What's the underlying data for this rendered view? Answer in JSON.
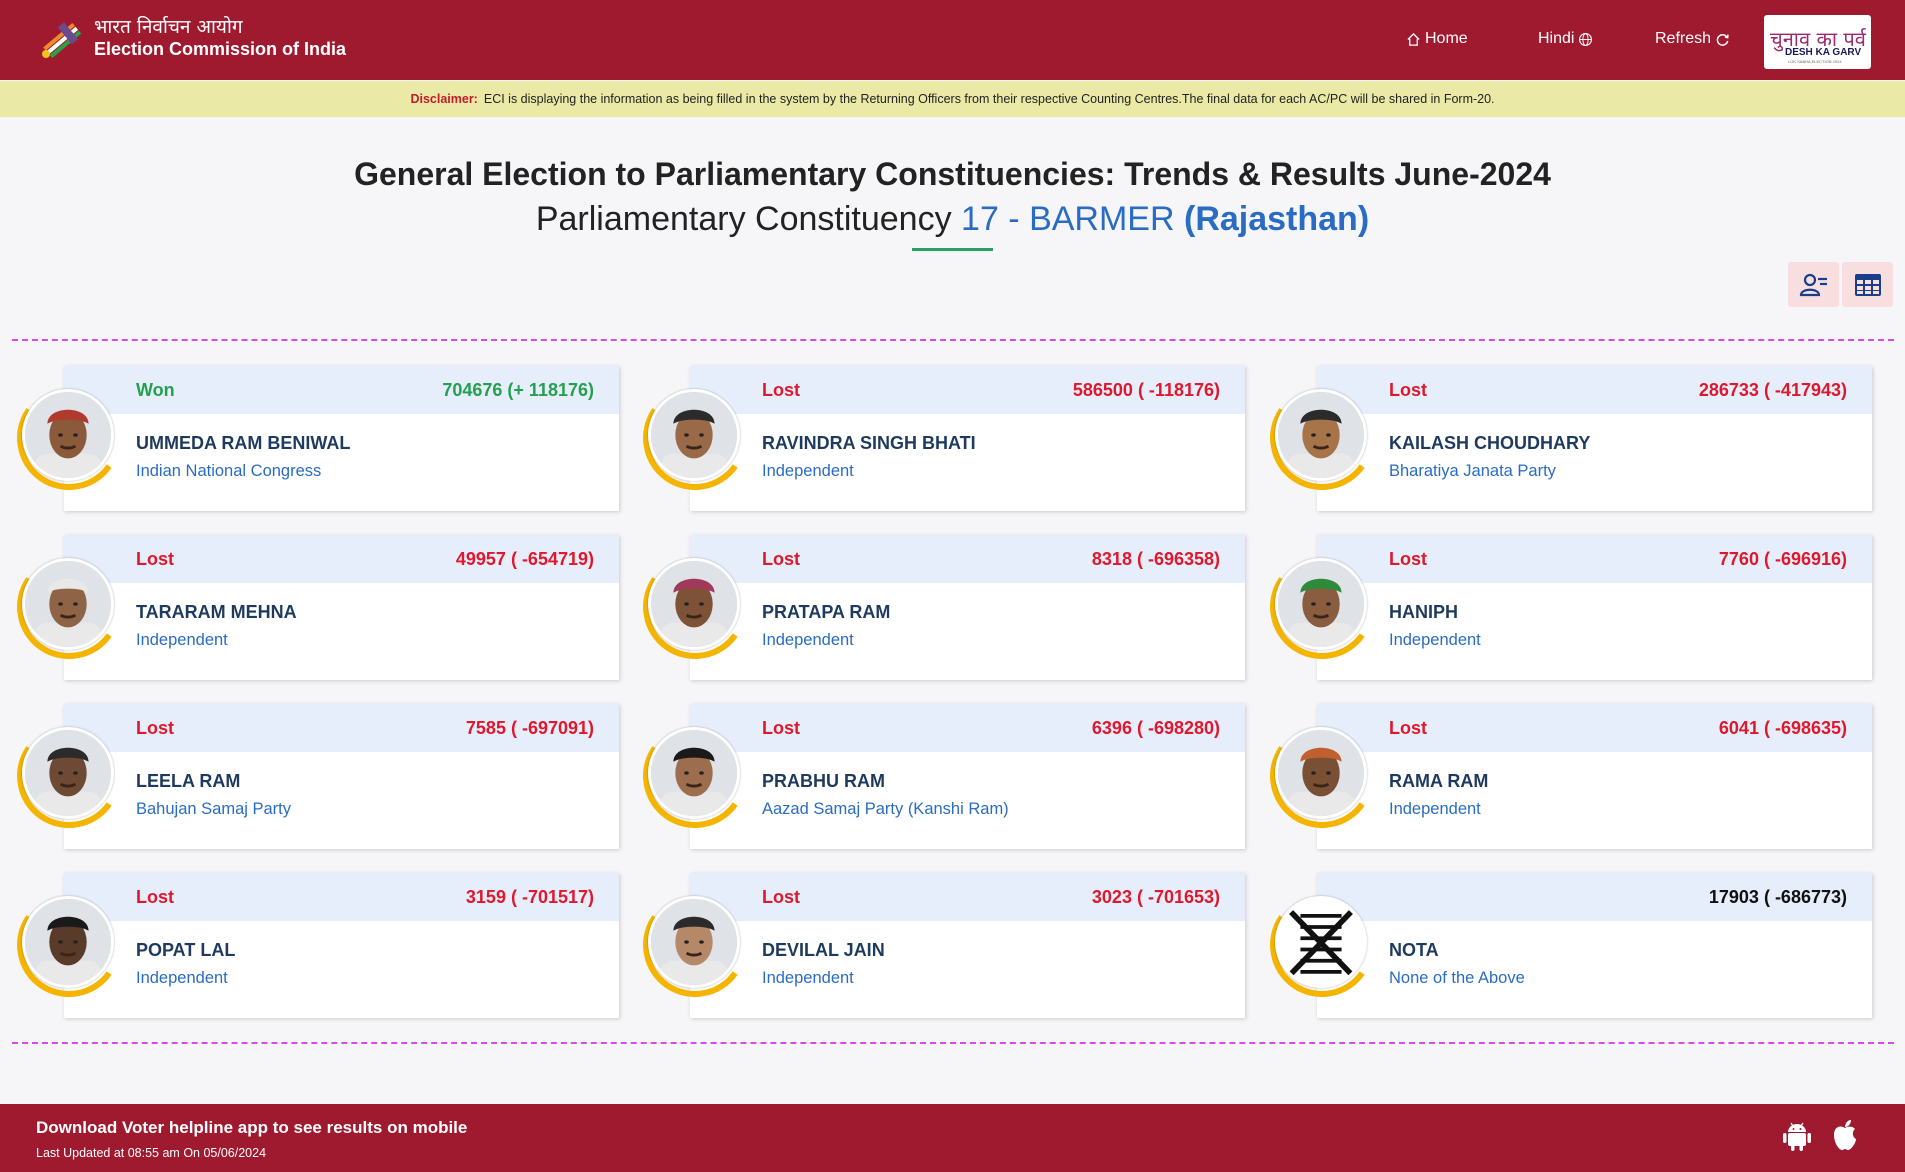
{
  "header": {
    "title_hi": "भारत निर्वाचन आयोग",
    "title_en": "Election Commission of India",
    "nav": {
      "home": "Home",
      "hindi": "Hindi",
      "refresh": "Refresh"
    },
    "badge": {
      "hi": "चुनाव का पर्व",
      "en": "DESH KA GARV",
      "sub": "LOK SABHA ELECTION 2024"
    },
    "colors": {
      "bar": "#a01a2f"
    }
  },
  "disclaimer": {
    "label": "Disclaimer:",
    "text": "ECI is displaying the information as being filled in the system by the Returning Officers from their respective Counting Centres.The final data for each AC/PC will be shared in Form-20."
  },
  "page": {
    "title": "General Election to Parliamentary Constituencies: Trends & Results June-2024",
    "subtitle_prefix": "Parliamentary Constituency",
    "constituency": "17 - BARMER",
    "state": "(Rajasthan)"
  },
  "view_toggles": {
    "cards_icon": "user-list-icon",
    "table_icon": "table-icon"
  },
  "candidates": [
    {
      "status": "Won",
      "votes": "704676 (+ 118176)",
      "name": "UMMEDA RAM BENIWAL",
      "party": "Indian National Congress"
    },
    {
      "status": "Lost",
      "votes": "586500 ( -118176)",
      "name": "RAVINDRA SINGH BHATI",
      "party": "Independent"
    },
    {
      "status": "Lost",
      "votes": "286733 ( -417943)",
      "name": "KAILASH CHOUDHARY",
      "party": "Bharatiya Janata Party"
    },
    {
      "status": "Lost",
      "votes": "49957 ( -654719)",
      "name": "TARARAM MEHNA",
      "party": "Independent"
    },
    {
      "status": "Lost",
      "votes": "8318 ( -696358)",
      "name": "PRATAPA RAM",
      "party": "Independent"
    },
    {
      "status": "Lost",
      "votes": "7760 ( -696916)",
      "name": "HANIPH",
      "party": "Independent"
    },
    {
      "status": "Lost",
      "votes": "7585 ( -697091)",
      "name": "LEELA RAM",
      "party": "Bahujan Samaj Party"
    },
    {
      "status": "Lost",
      "votes": "6396 ( -698280)",
      "name": "PRABHU RAM",
      "party": "Aazad Samaj Party (Kanshi Ram)"
    },
    {
      "status": "Lost",
      "votes": "6041 ( -698635)",
      "name": "RAMA RAM",
      "party": "Independent"
    },
    {
      "status": "Lost",
      "votes": "3159 ( -701517)",
      "name": "POPAT LAL",
      "party": "Independent"
    },
    {
      "status": "Lost",
      "votes": "3023 ( -701653)",
      "name": "DEVILAL JAIN",
      "party": "Independent"
    },
    {
      "status": "",
      "votes": "17903 ( -686773)",
      "name": "NOTA",
      "party": "None of the Above"
    }
  ],
  "footer": {
    "download": "Download Voter helpline app to see results on mobile",
    "updated": "Last Updated at 08:55 am On 05/06/2024",
    "icons": [
      "android-icon",
      "apple-icon"
    ]
  }
}
